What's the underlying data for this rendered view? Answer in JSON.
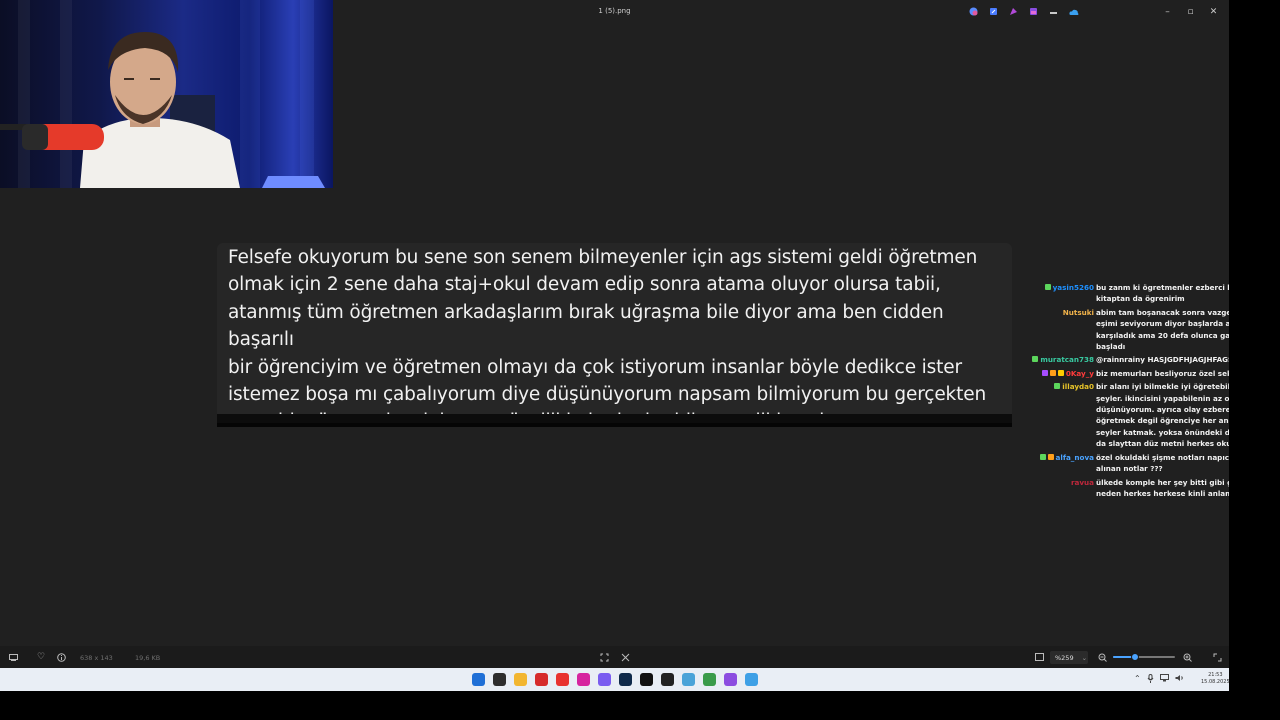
{
  "window": {
    "title": "1 (5).png",
    "minimize_glyph": "–",
    "maximize_glyph": "▫",
    "close_glyph": "✕"
  },
  "titlebar_icons": [
    "copilot-icon",
    "edit-icon",
    "paint-icon",
    "photos-icon",
    "share-icon",
    "cloud-icon"
  ],
  "card": {
    "lines": [
      "Felsefe okuyorum bu sene son senem bilmeyenler için ags sistemi geldi öğretmen",
      "olmak için 2 sene daha staj+okul devam edip sonra atama oluyor olursa tabii,",
      "atanmış tüm öğretmen arkadaşlarım bırak uğraşma bile diyor ama ben cidden başarılı",
      "bir öğrenciyim ve öğretmen olmayı da çok istiyorum insanlar böyle dedikce ister",
      "istemez boşa mı çabalıyorum diye düşünüyorum napsam bilmiyorum bu gerçekten",
      "uzun bir süreç gelecek kaygısı özellikle bu kadar bilşnmezlikle çok zor"
    ]
  },
  "chat": [
    {
      "user": "yasin5260",
      "color": "#1e90ff",
      "badges": [
        "#5cd65c"
      ],
      "text": "bu zanm ki ögretmenler ezberci ben onu kitaptan da ögrenirim"
    },
    {
      "user": "Nutsuki",
      "color": "#f0b24a",
      "badges": [],
      "text": "abim tam boşanacak sonra vazgeçiyor ben eşimi seviyorum diyor başlarda anlayışla karşıladık ama 20 defa olunca garip olmaya başladı"
    },
    {
      "user": "muratcan738",
      "color": "#38c9a0",
      "badges": [
        "#5cd65c"
      ],
      "text": "@rainnrainy HASJGDFHJAGJHFAGS"
    },
    {
      "user": "0Kay_y",
      "color": "#ff3b3b",
      "badges": [
        "#a64dff",
        "#ff9f1a",
        "#ffcc00"
      ],
      "text": "biz memurları besliyoruz özel sektör olarak"
    },
    {
      "user": "illayda0",
      "color": "#e6c229",
      "badges": [
        "#5cd65c"
      ],
      "text": "bir alanı iyi bilmekle iyi öğretebilmek farklı şeyler. ikincisini yapabilenin az olduğunu düşünüyorum. ayrıca olay ezbere bi seyler öğretmek degil öğrenciye her anlamda bi seyler katmak. yoksa önündeki defterden ya da slayttan düz metni herkes okur"
    },
    {
      "user": "alfa_nova",
      "color": "#4aa3ff",
      "badges": [
        "#5cd65c",
        "#ff9f1a"
      ],
      "text": "özel okuldaki şişme notları napıcaz parayla alınan notlar ???"
    },
    {
      "user": "ravua",
      "color": "#c0283c",
      "badges": [],
      "text": "ülkede komple her şey bitti gibi geliyor artık neden herkes herkese kinli anlamıyorum"
    }
  ],
  "viewer_bar": {
    "dimensions": "638 x 143",
    "file_size": "19,6 KB",
    "zoom": "%259",
    "zoom_level_fraction": 0.35
  },
  "taskbar": {
    "apps": [
      {
        "name": "start",
        "color": "#1f6fd6"
      },
      {
        "name": "task-view",
        "color": "#2d2d2d"
      },
      {
        "name": "file-explorer",
        "color": "#f2b630"
      },
      {
        "name": "app-3",
        "color": "#d62b2b"
      },
      {
        "name": "opera",
        "color": "#e8322f"
      },
      {
        "name": "instagram",
        "color": "#d6249f"
      },
      {
        "name": "discord",
        "color": "#7a5cf0"
      },
      {
        "name": "photoshop",
        "color": "#0f2a4a"
      },
      {
        "name": "tiktok",
        "color": "#111111"
      },
      {
        "name": "capcut",
        "color": "#222222"
      },
      {
        "name": "app-10",
        "color": "#4aa3d8"
      },
      {
        "name": "chrome",
        "color": "#3a9b4a"
      },
      {
        "name": "app-12",
        "color": "#8c4de0"
      },
      {
        "name": "photos",
        "color": "#3ea0e6"
      }
    ],
    "time": "21:53",
    "date": "15.08.2025"
  }
}
